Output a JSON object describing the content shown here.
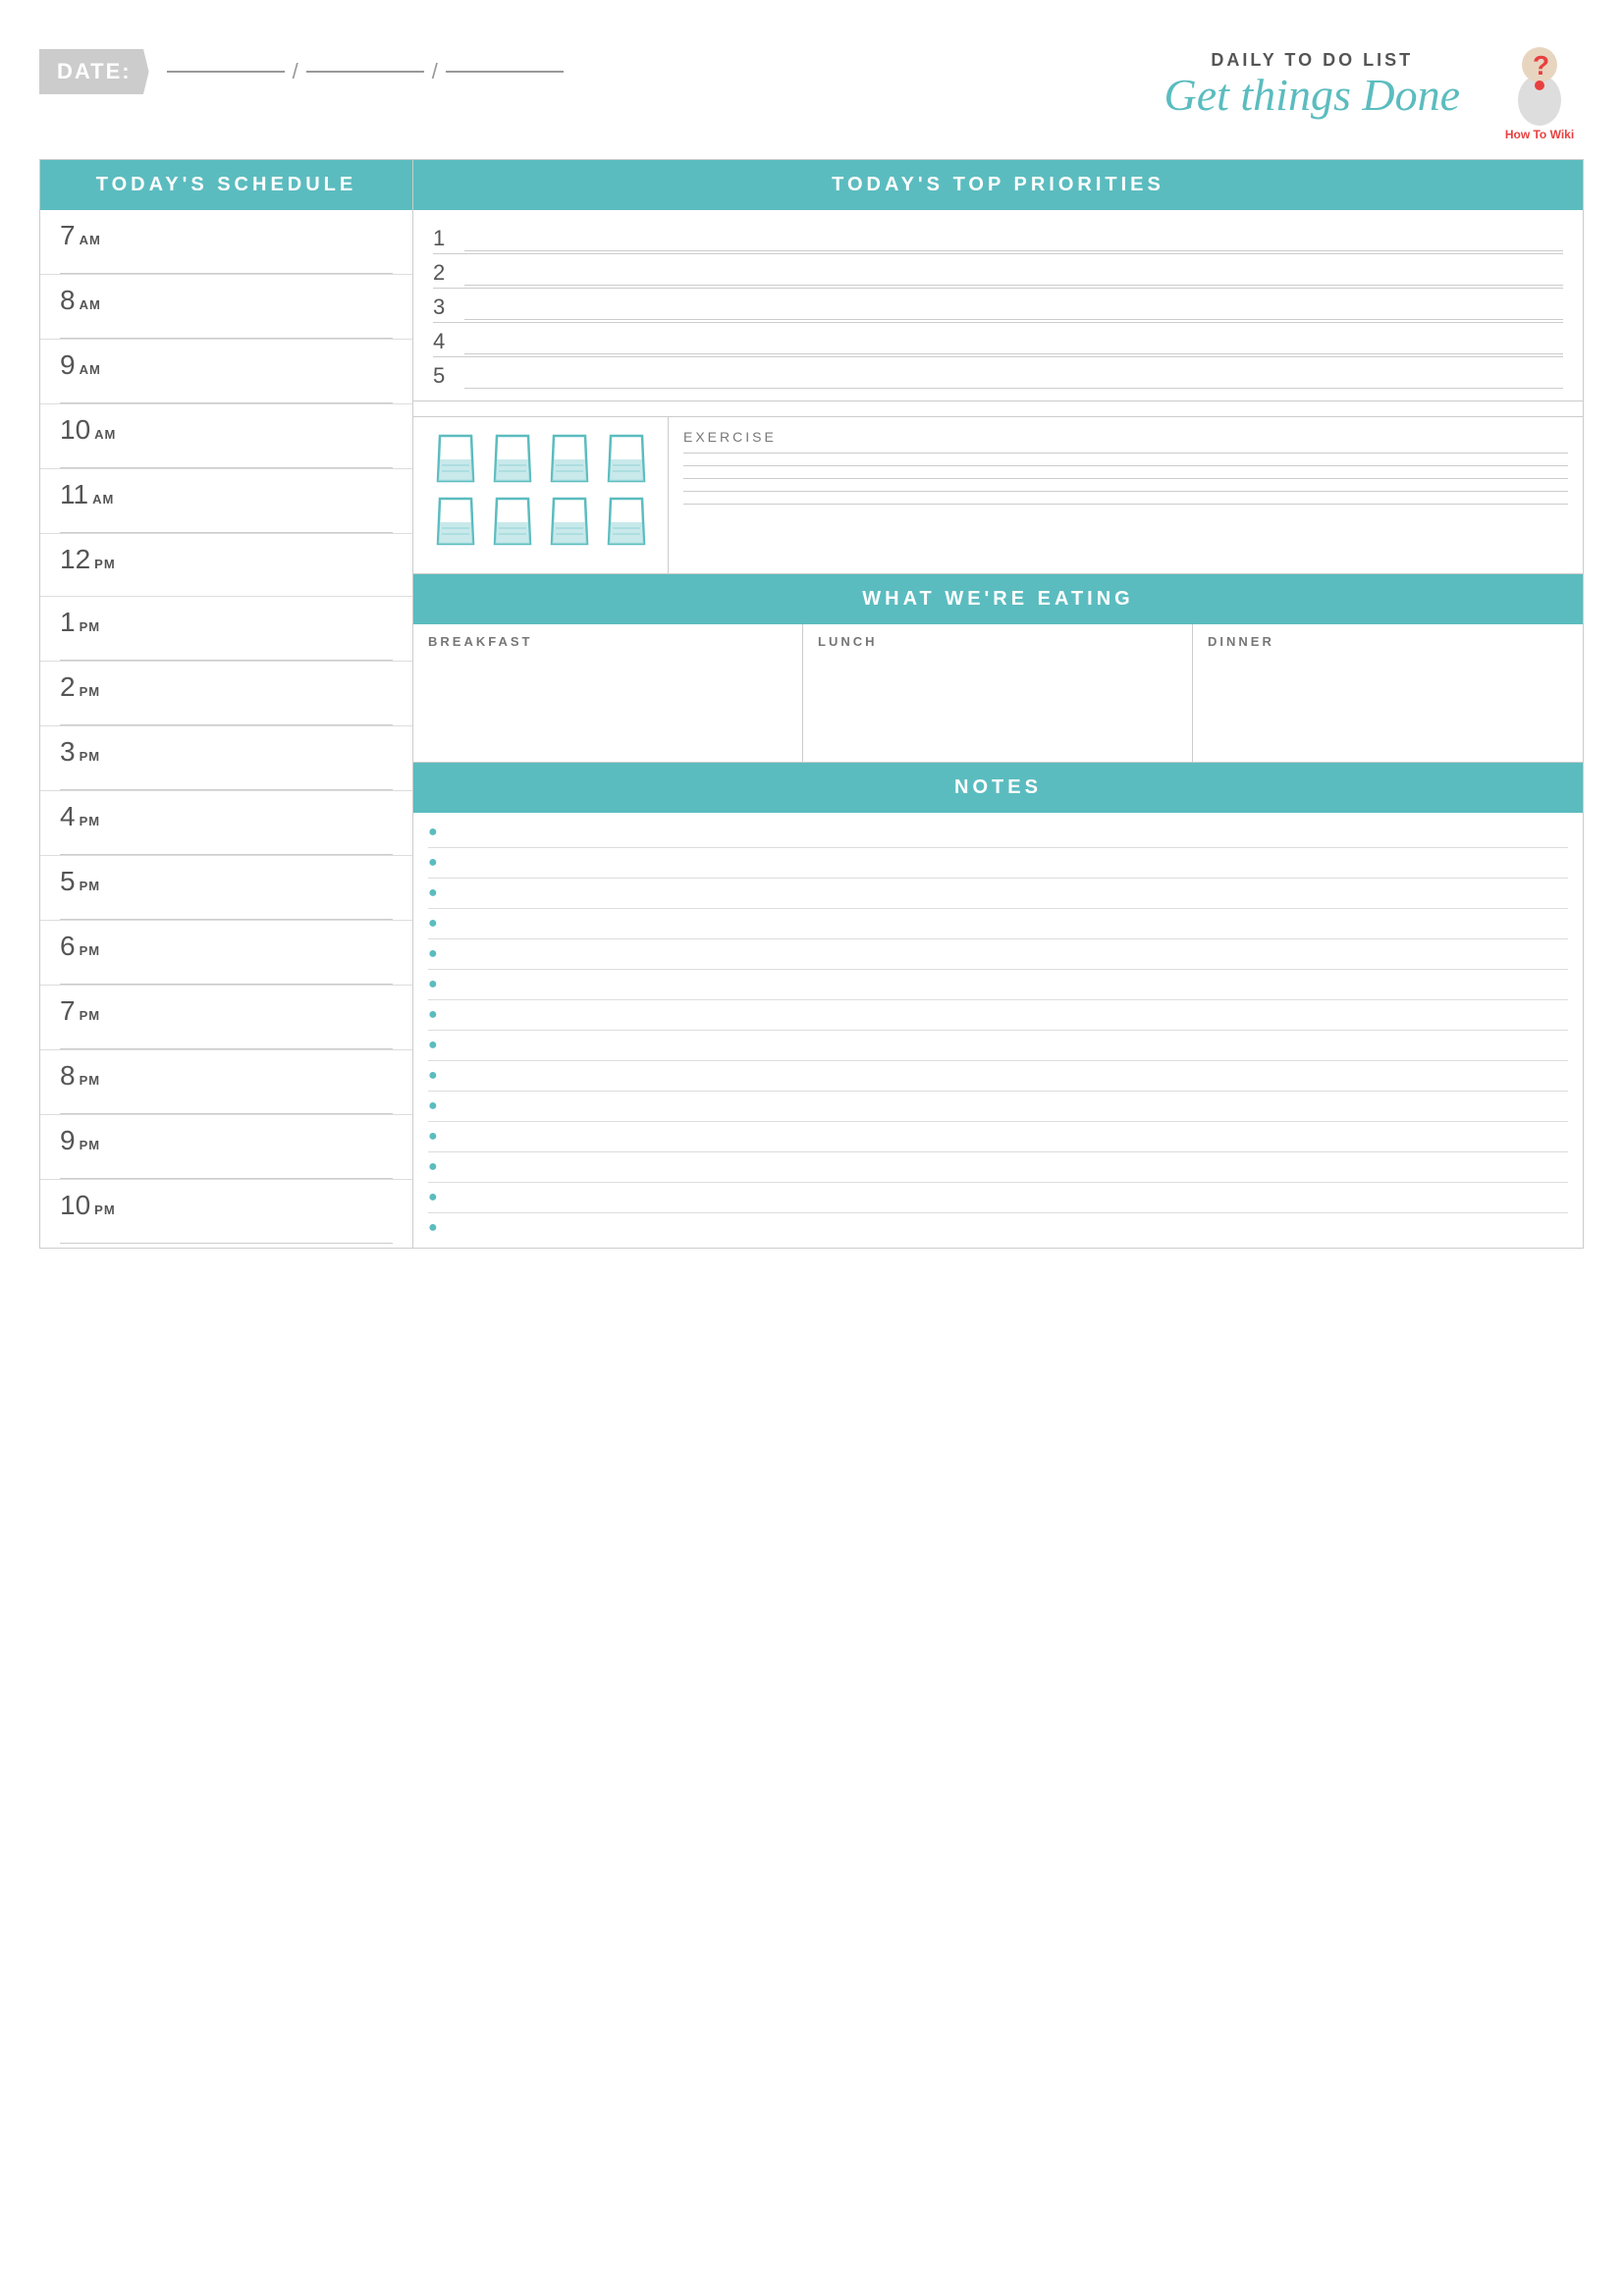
{
  "header": {
    "date_label": "DATE:",
    "subtitle": "DAILY TO DO LIST",
    "title": "Get things Done",
    "logo_text": "How To Wiki"
  },
  "schedule": {
    "header": "TODAY'S SCHEDULE",
    "slots": [
      {
        "number": "7",
        "ampm": "AM"
      },
      {
        "number": "8",
        "ampm": "AM"
      },
      {
        "number": "9",
        "ampm": "AM"
      },
      {
        "number": "10",
        "ampm": "AM"
      },
      {
        "number": "11",
        "ampm": "AM"
      },
      {
        "number": "12",
        "ampm": "PM"
      },
      {
        "number": "1",
        "ampm": "PM"
      },
      {
        "number": "2",
        "ampm": "PM"
      },
      {
        "number": "3",
        "ampm": "PM"
      },
      {
        "number": "4",
        "ampm": "PM"
      },
      {
        "number": "5",
        "ampm": "PM"
      },
      {
        "number": "6",
        "ampm": "PM"
      },
      {
        "number": "7",
        "ampm": "PM"
      },
      {
        "number": "8",
        "ampm": "PM"
      },
      {
        "number": "9",
        "ampm": "PM"
      },
      {
        "number": "10",
        "ampm": "PM"
      }
    ]
  },
  "priorities": {
    "header": "TODAY'S TOP PRIORITIES",
    "items": [
      "1",
      "2",
      "3",
      "4",
      "5"
    ]
  },
  "water": {
    "glasses_per_row": 4,
    "rows": 2
  },
  "exercise": {
    "label": "EXERCISE",
    "lines": 5
  },
  "eating": {
    "header": "WHAT WE'RE EATING",
    "columns": [
      "BREAKFAST",
      "LUNCH",
      "DINNER"
    ]
  },
  "notes": {
    "header": "NOTES",
    "bullet_count": 14
  },
  "colors": {
    "teal": "#5bbcbf",
    "light_gray": "#ccc",
    "text": "#555"
  }
}
